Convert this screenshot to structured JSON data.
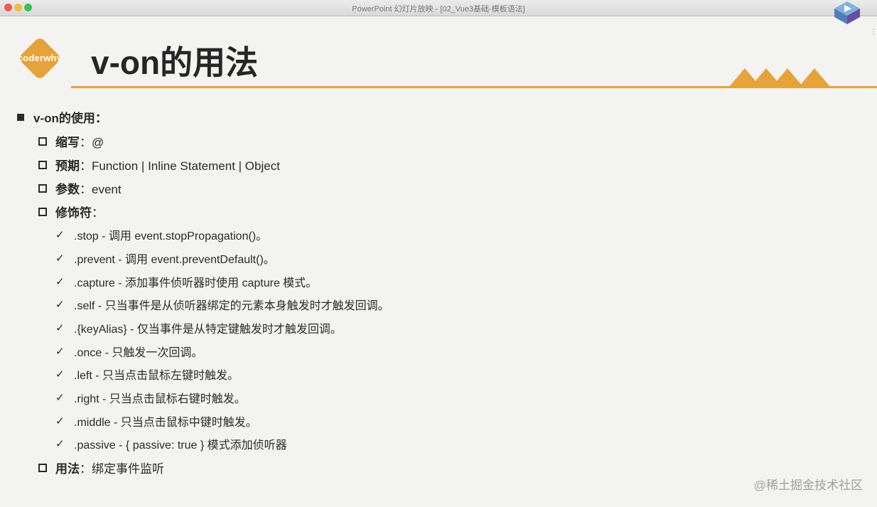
{
  "window": {
    "title": "PowerPoint 幻灯片放映 - [02_Vue3基础-模板语法]"
  },
  "slide": {
    "logo_text": "coderwhy",
    "title": "v-on的用法",
    "heading": "v-on的使用：",
    "items": [
      {
        "label": "缩写",
        "value": "：@"
      },
      {
        "label": "预期",
        "value": "：Function | Inline Statement | Object"
      },
      {
        "label": "参数",
        "value": "：event"
      },
      {
        "label": "修饰符",
        "value": "："
      }
    ],
    "modifiers": [
      ".stop - 调用 event.stopPropagation()。",
      ".prevent - 调用 event.preventDefault()。",
      ".capture - 添加事件侦听器时使用 capture 模式。",
      ".self - 只当事件是从侦听器绑定的元素本身触发时才触发回调。",
      ".{keyAlias} - 仅当事件是从特定键触发时才触发回调。",
      ".once - 只触发一次回调。",
      ".left - 只当点击鼠标左键时触发。",
      ".right - 只当点击鼠标右键时触发。",
      ".middle - 只当点击鼠标中键时触发。",
      ".passive - { passive: true } 模式添加侦听器"
    ],
    "usage": {
      "label": "用法",
      "value": "：绑定事件监听"
    }
  },
  "watermark": "@稀土掘金技术社区",
  "colors": {
    "accent": "#e6a33a",
    "background": "#f3f3f1",
    "text": "#2a2a2a"
  },
  "icons": [
    "play-badge-icon",
    "mountains-decoration",
    "coderwhy-logo",
    "check-icon"
  ]
}
